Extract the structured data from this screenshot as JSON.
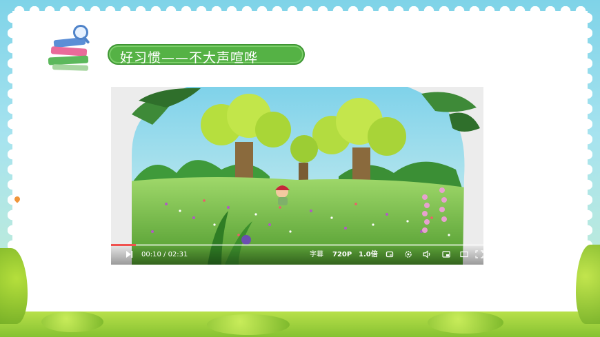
{
  "slide": {
    "title": "好习惯——不大声喧哗"
  },
  "video_player": {
    "current_time": "00:10",
    "separator": " / ",
    "total_time": "02:31",
    "progress": 0.066,
    "subtitle_label": "字幕",
    "quality_label": "720P",
    "speed_label": "1.0倍",
    "icons": [
      "play-icon",
      "loop-icon",
      "settings-icon",
      "volume-icon",
      "picture-in-picture-icon",
      "widescreen-icon",
      "fullscreen-icon"
    ]
  },
  "colors": {
    "title_pill": "#55b245",
    "progress": "#f0524f",
    "background_top": "#7fd3e8"
  }
}
